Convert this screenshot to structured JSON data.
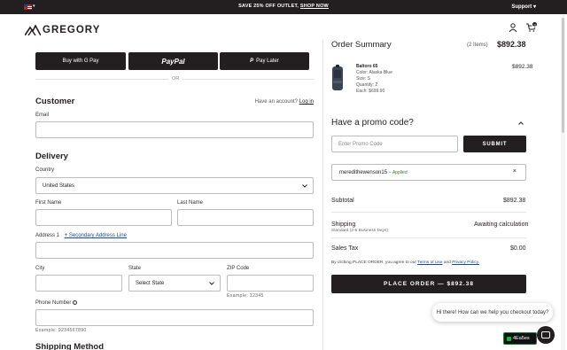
{
  "topbar": {
    "promo_text": "SAVE 25% OFF OUTLET,",
    "promo_link": "SHOP NOW",
    "support_label": "Support ▾",
    "flag_caret": "▾"
  },
  "header": {
    "logo_text": "GREGORY",
    "cart_count": "3"
  },
  "express": {
    "gpay_label": "Buy with  G Pay",
    "paypal_label": "PayPal",
    "paylater_label": "Pay Later",
    "or_label": "OR"
  },
  "customer": {
    "title": "Customer",
    "account_prompt": "Have an account?",
    "login_link": "Log in",
    "email_label": "Email",
    "email_value": ""
  },
  "delivery": {
    "title": "Delivery",
    "country_label": "Country",
    "country_value": "United States",
    "first_name_label": "First Name",
    "last_name_label": "Last Name",
    "address1_label": "Address 1",
    "secondary_link": "+ Secondary Address Line",
    "city_label": "City",
    "state_label": "State",
    "state_value": "Select State",
    "zip_label": "ZIP Code",
    "zip_hint": "Example: 12345",
    "phone_label": "Phone Number",
    "phone_hint": "Example: 9234567890"
  },
  "shipping_method": {
    "title": "Shipping Method"
  },
  "summary": {
    "title": "Order Summary",
    "items_count": "(2 Items)",
    "total": "$892.38",
    "product": {
      "name": "Baltoro 65",
      "color": "Color: Alaska Blue",
      "size": "Size: S",
      "quantity": "Quantity: 2",
      "each": "Each: $699.90",
      "price": "$892.38"
    },
    "promo_title": "Have a promo code?",
    "promo_placeholder": "Enter Promo Code",
    "submit_label": "SUBMIT",
    "applied_code": "meredithewenson15",
    "applied_tag": "– Applied",
    "subtotal_label": "Subtotal",
    "subtotal_value": "$892.38",
    "shipping_label": "Shipping",
    "shipping_value": "Awaiting calculation",
    "shipping_sub": "Standard (2-6 Business Days)",
    "tax_label": "Sales Tax",
    "tax_value": "$0.00",
    "terms_prefix": "By clicking PLACE ORDER, you agree to our",
    "terms_link": "Terms of Use",
    "terms_and": "and",
    "privacy_link": "Privacy Policy.",
    "place_order_label": "PLACE ORDER — $892.38"
  },
  "chat": {
    "bubble_text": "Hi there! How can we help you checkout today?",
    "badge_label": "4Ea5es"
  }
}
